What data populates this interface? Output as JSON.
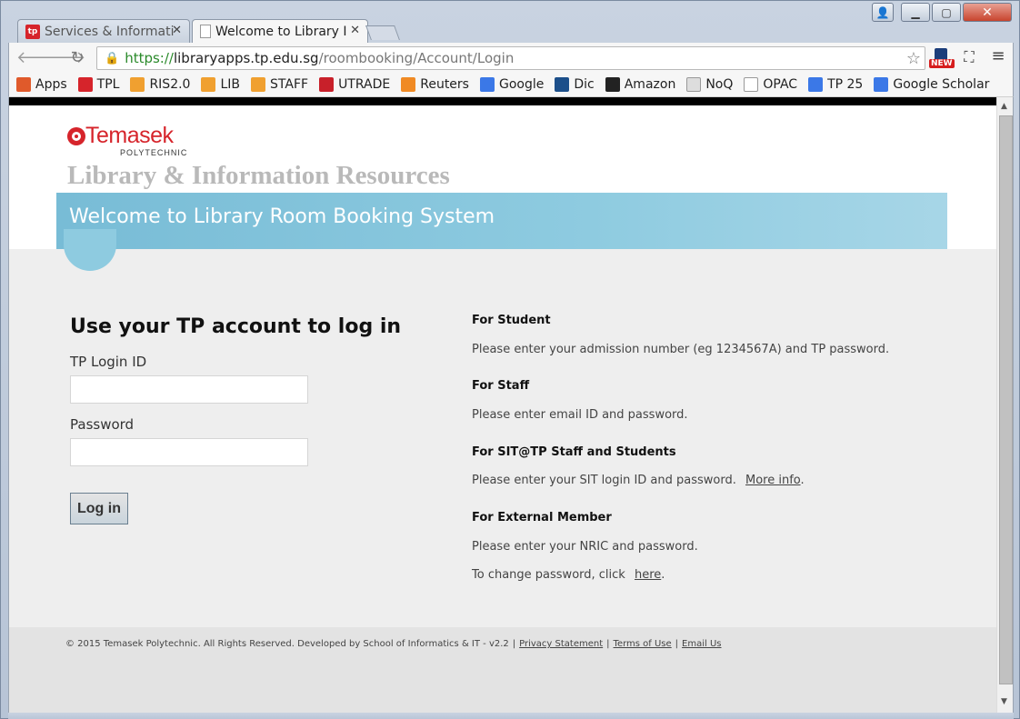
{
  "browser": {
    "tabs": [
      {
        "label": "Services & Informati",
        "active": false,
        "icon": "tp-favicon"
      },
      {
        "label": "Welcome to Library I",
        "active": true,
        "icon": "document-favicon"
      }
    ],
    "url": {
      "scheme": "https://",
      "host": "libraryapps.tp.edu.sg",
      "path": "/roombooking/Account/Login"
    },
    "extension_badge": "NEW",
    "bookmarks": [
      {
        "label": "Apps",
        "icon": "apps-grid-icon",
        "color": "#e05a2b"
      },
      {
        "label": "TPL",
        "icon": "tp-icon",
        "color": "#d6242b"
      },
      {
        "label": "RIS2.0",
        "icon": "ris-icon",
        "color": "#f0a030"
      },
      {
        "label": "LIB",
        "icon": "lib-icon",
        "color": "#f0a030"
      },
      {
        "label": "STAFF",
        "icon": "staff-icon",
        "color": "#f0a030"
      },
      {
        "label": "UTRADE",
        "icon": "utrade-icon",
        "color": "#c8202a"
      },
      {
        "label": "Reuters",
        "icon": "reuters-icon",
        "color": "#f08a24"
      },
      {
        "label": "Google",
        "icon": "google-icon",
        "color": "#3b78e7"
      },
      {
        "label": "Dic",
        "icon": "dictionary-icon",
        "color": "#1c4f8a"
      },
      {
        "label": "Amazon",
        "icon": "amazon-icon",
        "color": "#222222"
      },
      {
        "label": "NoQ",
        "icon": "noq-icon",
        "color": "#dddddd"
      },
      {
        "label": "OPAC",
        "icon": "page-icon",
        "color": "#ffffff"
      },
      {
        "label": "TP 25",
        "icon": "google-icon",
        "color": "#3b78e7"
      },
      {
        "label": "Google Scholar",
        "icon": "scholar-icon",
        "color": "#3b78e7"
      }
    ]
  },
  "page": {
    "logo": {
      "name": "Temasek",
      "sub": "POLYTECHNIC"
    },
    "site_title": "Library & Information Resources",
    "banner": "Welcome to Library Room Booking System",
    "login": {
      "heading": "Use your TP account to log in",
      "id_label": "TP Login ID",
      "id_value": "",
      "password_label": "Password",
      "password_value": "",
      "button": "Log in"
    },
    "info": {
      "student_head": "For Student",
      "student_text": "Please enter your admission number (eg 1234567A) and TP password.",
      "staff_head": "For Staff",
      "staff_text": "Please enter email ID and password.",
      "sit_head": "For SIT@TP Staff and Students",
      "sit_text": "Please enter your SIT login ID and password.",
      "sit_link": "More info",
      "external_head": "For External Member",
      "external_text": "Please enter your NRIC and password.",
      "change_text": "To change password, click",
      "change_link": "here"
    },
    "footer": {
      "copyright": "© 2015 Temasek Polytechnic. All Rights Reserved. Developed by School of Informatics & IT - v2.2",
      "privacy": "Privacy Statement",
      "terms": "Terms of Use",
      "email": "Email Us"
    }
  },
  "colors": {
    "brand_red": "#d6242b",
    "banner_blue": "#8ecbe0",
    "url_green": "#2a8a2a"
  }
}
